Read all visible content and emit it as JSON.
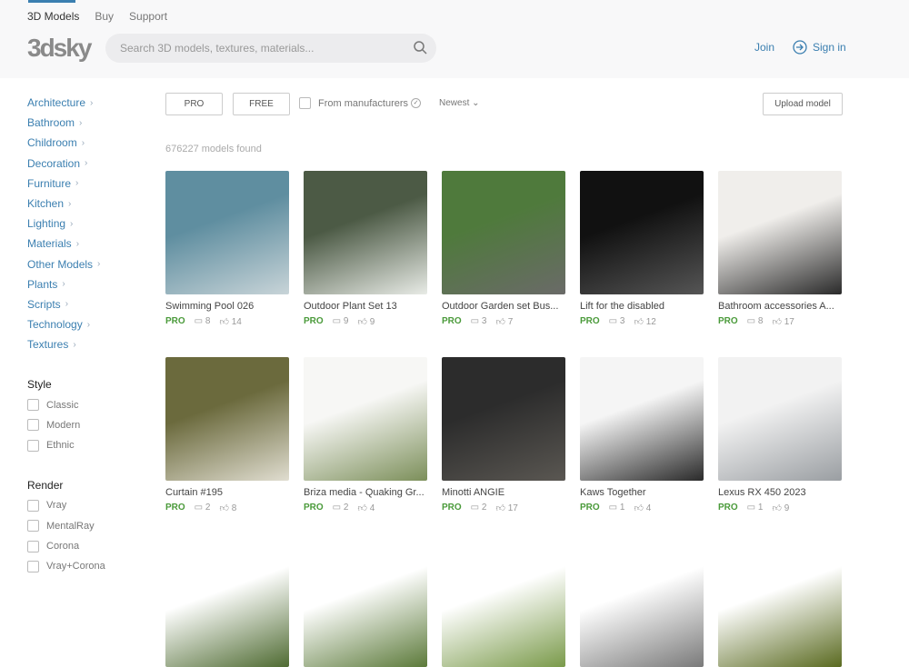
{
  "nav": {
    "tabs": [
      "3D Models",
      "Buy",
      "Support"
    ]
  },
  "logo": "3dsky",
  "search": {
    "placeholder": "Search 3D models, textures, materials..."
  },
  "auth": {
    "join": "Join",
    "signin": "Sign in"
  },
  "categories": [
    "Architecture",
    "Bathroom",
    "Childroom",
    "Decoration",
    "Furniture",
    "Kitchen",
    "Lighting",
    "Materials",
    "Other Models",
    "Plants",
    "Scripts",
    "Technology",
    "Textures"
  ],
  "style": {
    "title": "Style",
    "options": [
      "Classic",
      "Modern",
      "Ethnic"
    ]
  },
  "render": {
    "title": "Render",
    "options": [
      "Vray",
      "MentalRay",
      "Corona",
      "Vray+Corona"
    ]
  },
  "filters": {
    "pro": "PRO",
    "free": "FREE",
    "manufacturers": "From manufacturers",
    "sort": "Newest",
    "upload": "Upload model"
  },
  "count": "676227 models found",
  "colors": {
    "accent": "#3b7fb0",
    "pro": "#4a9a3a"
  },
  "models": [
    {
      "title": "Swimming Pool 026",
      "badge": "PRO",
      "comments": "8",
      "likes": "14",
      "c1": "#5f8ea0",
      "c2": "#c8d4d8"
    },
    {
      "title": "Outdoor Plant Set 13",
      "badge": "PRO",
      "comments": "9",
      "likes": "9",
      "c1": "#4c5a45",
      "c2": "#e8ebe6"
    },
    {
      "title": "Outdoor Garden set Bus...",
      "badge": "PRO",
      "comments": "3",
      "likes": "7",
      "c1": "#4f7a3c",
      "c2": "#6a6a68"
    },
    {
      "title": "Lift for the disabled",
      "badge": "PRO",
      "comments": "3",
      "likes": "12",
      "c1": "#111111",
      "c2": "#555555"
    },
    {
      "title": "Bathroom accessories A...",
      "badge": "PRO",
      "comments": "8",
      "likes": "17",
      "c1": "#f0eeeb",
      "c2": "#2a2a2a"
    },
    {
      "title": "Curtain #195",
      "badge": "PRO",
      "comments": "2",
      "likes": "8",
      "c1": "#6b6a3d",
      "c2": "#e0ddd0"
    },
    {
      "title": "Briza media - Quaking Gr...",
      "badge": "PRO",
      "comments": "2",
      "likes": "4",
      "c1": "#f7f7f5",
      "c2": "#7c8f5a"
    },
    {
      "title": "Minotti ANGIE",
      "badge": "PRO",
      "comments": "2",
      "likes": "17",
      "c1": "#2c2c2c",
      "c2": "#5a5752"
    },
    {
      "title": "Kaws Together",
      "badge": "PRO",
      "comments": "1",
      "likes": "4",
      "c1": "#f5f5f5",
      "c2": "#2a2a2a"
    },
    {
      "title": "Lexus RX 450 2023",
      "badge": "PRO",
      "comments": "1",
      "likes": "9",
      "c1": "#f2f2f2",
      "c2": "#9a9ea2"
    },
    {
      "title": "",
      "badge": "",
      "comments": "",
      "likes": "",
      "c1": "#ffffff",
      "c2": "#4f6b32"
    },
    {
      "title": "",
      "badge": "",
      "comments": "",
      "likes": "",
      "c1": "#ffffff",
      "c2": "#5c7a3a"
    },
    {
      "title": "",
      "badge": "",
      "comments": "",
      "likes": "",
      "c1": "#ffffff",
      "c2": "#7a9a4a"
    },
    {
      "title": "",
      "badge": "",
      "comments": "",
      "likes": "",
      "c1": "#ffffff",
      "c2": "#7a7a7a"
    },
    {
      "title": "",
      "badge": "",
      "comments": "",
      "likes": "",
      "c1": "#ffffff",
      "c2": "#5a6a20"
    }
  ]
}
